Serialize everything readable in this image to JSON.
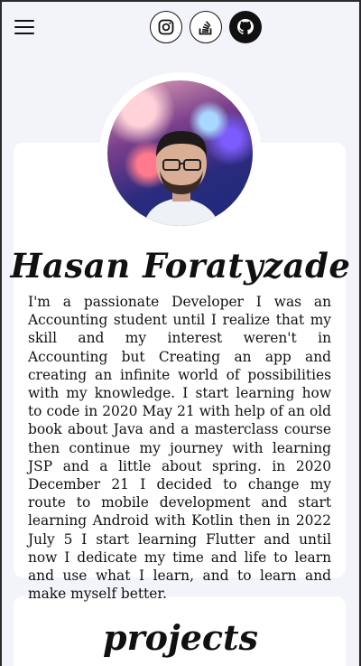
{
  "header": {
    "social_icons": [
      "instagram-icon",
      "stackoverflow-icon",
      "github-icon"
    ]
  },
  "profile": {
    "name": "Hasan Foratyzade",
    "bio": "I'm a passionate Developer I was an Accounting student until I realize that my skill and my interest weren't in Accounting but Creating an app and creating an infinite world of possibilities with my knowledge. I start learning how to code in 2020 May 21 with help of an old book about Java and a masterclass course then continue my journey with learning JSP and a little about spring. in 2020 December 21 I decided to change my route to mobile development and start learning Android with Kotlin then in 2022 July 5 I start learning Flutter and until now I dedicate my time and life to learn and use what I learn, and to learn and make myself better."
  },
  "projects": {
    "title": "projects"
  },
  "colors": {
    "background": "#f3f4f9",
    "card": "#ffffff",
    "text": "#111111"
  }
}
